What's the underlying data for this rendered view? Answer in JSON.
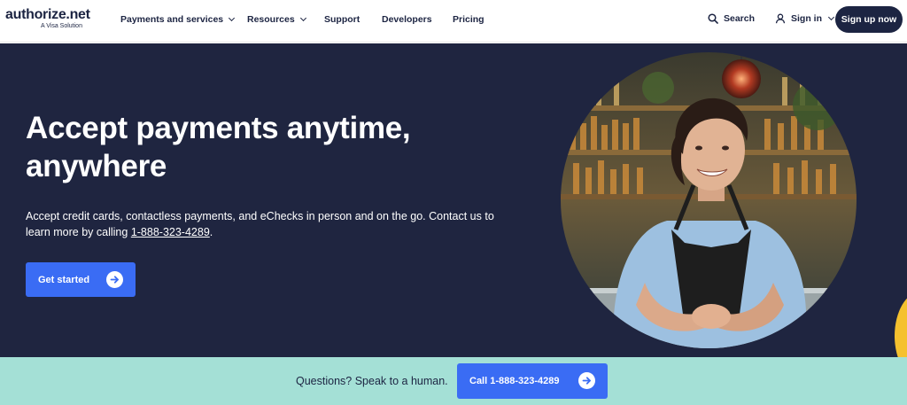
{
  "header": {
    "logo_text": "authorize",
    "logo_dot": ".",
    "logo_net": "net",
    "logo_sub": "A Visa Solution",
    "nav": {
      "payments": "Payments and services",
      "resources": "Resources",
      "support": "Support",
      "developers": "Developers",
      "pricing": "Pricing"
    },
    "search_label": "Search",
    "signin_label": "Sign in",
    "signup_label": "Sign up now"
  },
  "hero": {
    "title": "Accept payments anytime, anywhere",
    "text_before": "Accept credit cards, contactless payments, and eChecks in person and on the go. Contact us to learn more by calling ",
    "phone": "1-888-323-4289",
    "text_after": ".",
    "cta_label": "Get started"
  },
  "strip": {
    "question": "Questions? Speak to a human.",
    "call_label": "Call 1-888-323-4289"
  },
  "colors": {
    "navy": "#1f2540",
    "accent_blue": "#3a6cf4",
    "mint": "#a4e0d6",
    "yellow": "#f5c12e"
  },
  "icons": {
    "search": "search-icon",
    "user": "user-icon",
    "arrow": "arrow-right-icon"
  }
}
